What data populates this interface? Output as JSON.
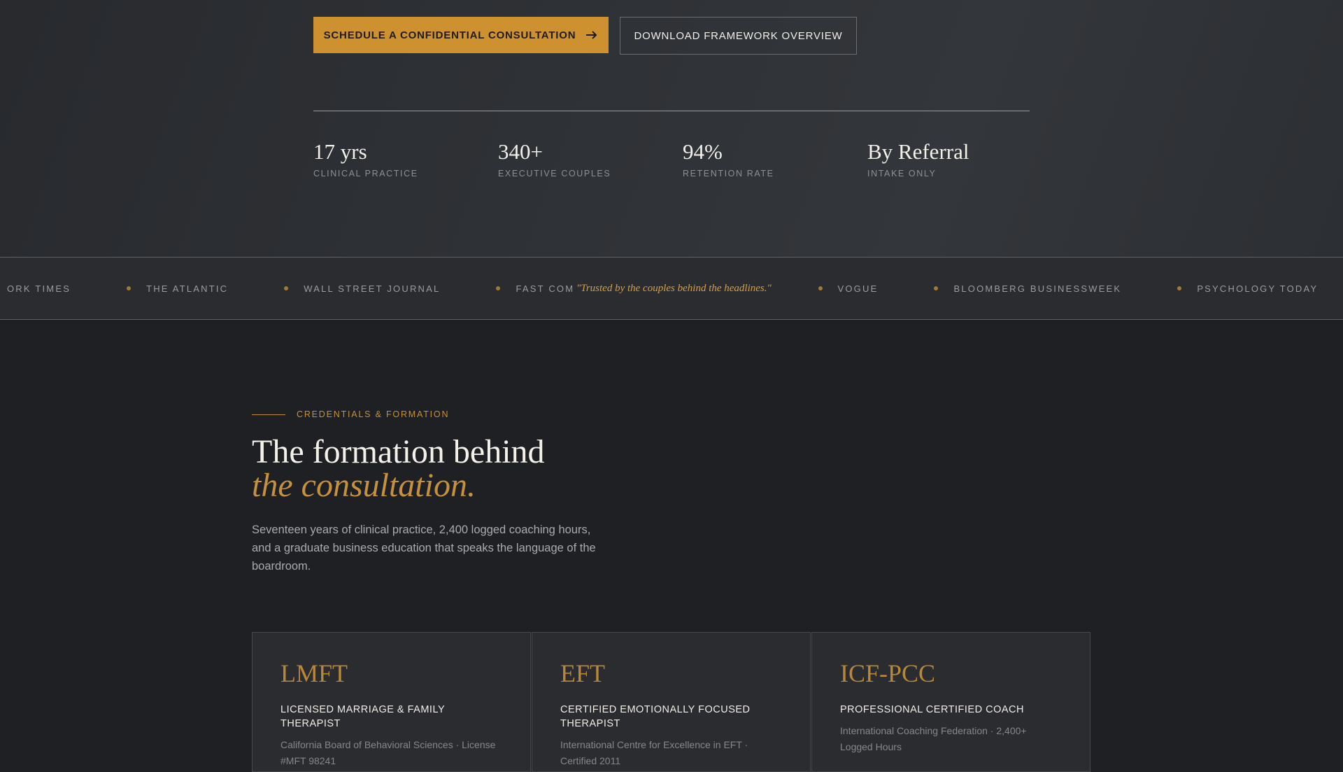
{
  "hero": {
    "primary_cta": "SCHEDULE A CONFIDENTIAL CONSULTATION",
    "primary_cta_icon": "arrow-right-icon",
    "secondary_cta": "DOWNLOAD FRAMEWORK OVERVIEW",
    "stats": [
      {
        "value": "17 yrs",
        "label": "CLINICAL PRACTICE"
      },
      {
        "value": "340+",
        "label": "EXECUTIVE COUPLES"
      },
      {
        "value": "94%",
        "label": "RETENTION RATE"
      },
      {
        "value": "By Referral",
        "label": "INTAKE ONLY"
      }
    ]
  },
  "ticker": {
    "quote": "\"Trusted by the couples behind the headlines.\"",
    "items": [
      "ORK TIMES",
      "THE ATLANTIC",
      "WALL STREET JOURNAL",
      "FAST COMPANY",
      "VOGUE",
      "BLOOMBERG BUSINESSWEEK",
      "PSYCHOLOGY TODAY"
    ]
  },
  "credentials": {
    "eyebrow": "CREDENTIALS & FORMATION",
    "headline_line1": "The formation behind",
    "headline_line2": "the consultation.",
    "lede": "Seventeen years of clinical practice, 2,400 logged coaching hours, and a graduate business education that speaks the language of the boardroom.",
    "cards": [
      {
        "abbr": "LMFT",
        "title": "LICENSED MARRIAGE & FAMILY THERAPIST",
        "desc": "California Board of Behavioral Sciences · License #MFT 98241"
      },
      {
        "abbr": "EFT",
        "title": "CERTIFIED EMOTIONALLY FOCUSED THERAPIST",
        "desc": "International Centre for Excellence in EFT · Certified 2011"
      },
      {
        "abbr": "ICF-PCC",
        "title": "PROFESSIONAL CERTIFIED COACH",
        "desc": "International Coaching Federation · 2,400+ Logged Hours"
      }
    ]
  },
  "colors": {
    "accent": "#cd922f",
    "background": "#1f2023"
  }
}
